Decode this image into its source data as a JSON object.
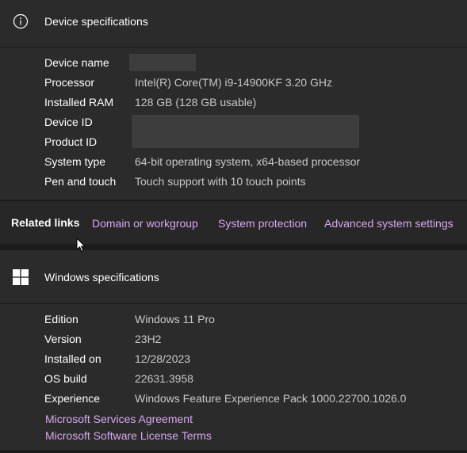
{
  "device_specs": {
    "title": "Device specifications",
    "rows": [
      {
        "label": "Device name",
        "value": ""
      },
      {
        "label": "Processor",
        "value": "Intel(R) Core(TM) i9-14900KF   3.20 GHz"
      },
      {
        "label": "Installed RAM",
        "value": "128 GB (128 GB usable)"
      },
      {
        "label": "Device ID",
        "value": ""
      },
      {
        "label": "Product ID",
        "value": ""
      },
      {
        "label": "System type",
        "value": "64-bit operating system, x64-based processor"
      },
      {
        "label": "Pen and touch",
        "value": "Touch support with 10 touch points"
      }
    ]
  },
  "related_links": {
    "title": "Related links",
    "links": [
      "Domain or workgroup",
      "System protection",
      "Advanced system settings"
    ]
  },
  "windows_specs": {
    "title": "Windows specifications",
    "rows": [
      {
        "label": "Edition",
        "value": "Windows 11 Pro"
      },
      {
        "label": "Version",
        "value": "23H2"
      },
      {
        "label": "Installed on",
        "value": "12/28/2023"
      },
      {
        "label": "OS build",
        "value": "22631.3958"
      },
      {
        "label": "Experience",
        "value": "Windows Feature Experience Pack 1000.22700.1026.0"
      }
    ],
    "links": [
      "Microsoft Services Agreement",
      "Microsoft Software License Terms"
    ]
  },
  "icons": {
    "device": "info-icon",
    "windows": "windows-logo-icon",
    "pointer": "mouse-cursor-icon"
  },
  "colors": {
    "background": "#1c1c1c",
    "card": "#2b2b2b",
    "link": "#d6a8f0",
    "value_text": "#c8c8c8"
  }
}
